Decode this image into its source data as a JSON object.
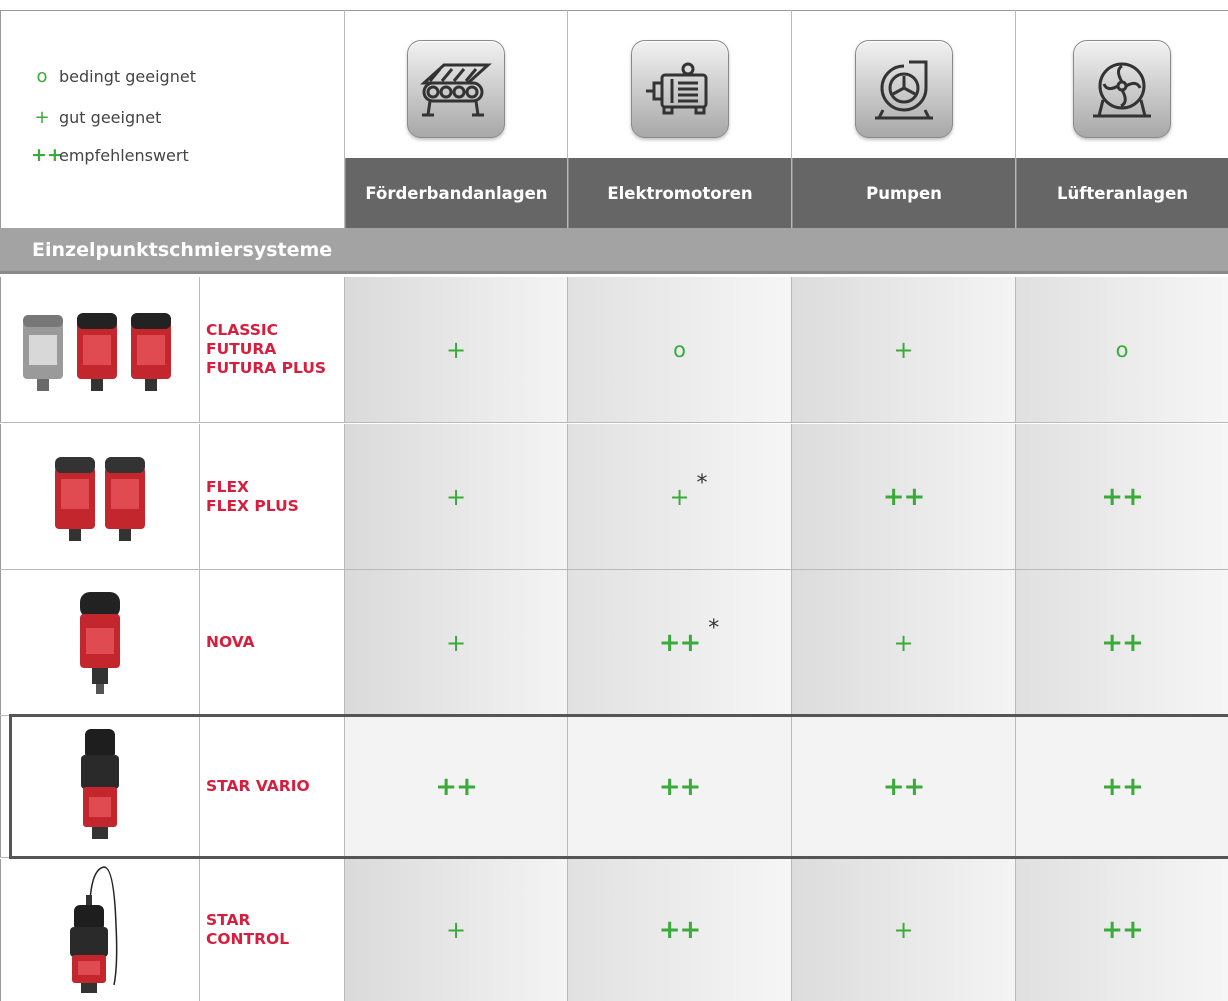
{
  "legend": {
    "items": [
      {
        "symbol": "o",
        "label": "bedingt geeignet"
      },
      {
        "symbol": "+",
        "label": "gut geeignet"
      },
      {
        "symbol": "++",
        "label": "empfehlenswert"
      }
    ]
  },
  "columns": [
    {
      "label": "Förderbandanlagen",
      "icon": "conveyor-belt-icon"
    },
    {
      "label": "Elektromotoren",
      "icon": "electric-motor-icon"
    },
    {
      "label": "Pumpen",
      "icon": "pump-icon"
    },
    {
      "label": "Lüfteranlagen",
      "icon": "fan-icon"
    }
  ],
  "section": {
    "title": "Einzelpunktschmiersysteme"
  },
  "rows": [
    {
      "names": [
        "CLASSIC",
        "FUTURA",
        "FUTURA PLUS"
      ],
      "values": [
        "+",
        "o",
        "+",
        "o"
      ],
      "footnote": "*",
      "image": "three-lubricator-cartridges"
    },
    {
      "names": [
        "FLEX",
        "FLEX PLUS"
      ],
      "values": [
        "+",
        "+*",
        "++",
        "++"
      ],
      "footnote": "*",
      "image": "two-lubricator-cartridges"
    },
    {
      "names": [
        "NOVA"
      ],
      "values": [
        "+",
        "++*",
        "+",
        "++"
      ],
      "footnote": "*",
      "image": "single-lubricator-cartridge"
    },
    {
      "names": [
        "STAR VARIO"
      ],
      "values": [
        "++",
        "++",
        "++",
        "++"
      ],
      "footnote": "*",
      "image": "star-vario-lubricator",
      "highlighted": true
    },
    {
      "names": [
        "STAR",
        "CONTROL"
      ],
      "values": [
        "+",
        "++",
        "+",
        "++"
      ],
      "footnote": "*",
      "image": "star-control-lubricator"
    }
  ],
  "colors": {
    "green": "#3aaa3a",
    "red": "#d61f3f",
    "header_gray": "#666666",
    "section_gray": "#a3a3a3"
  }
}
